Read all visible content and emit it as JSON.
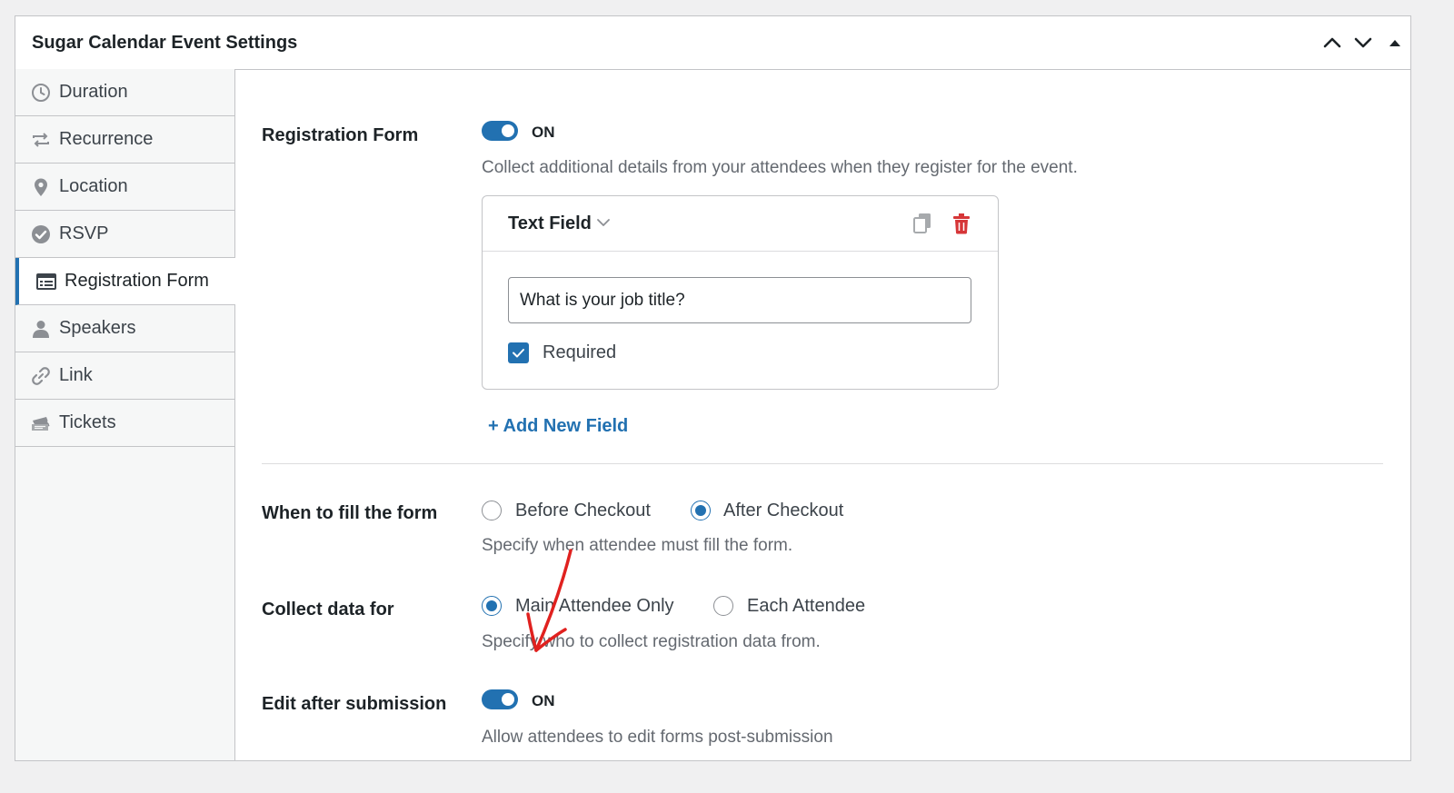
{
  "panel": {
    "title": "Sugar Calendar Event Settings"
  },
  "sidebar": {
    "items": [
      {
        "label": "Duration",
        "icon": "clock-icon"
      },
      {
        "label": "Recurrence",
        "icon": "repeat-icon"
      },
      {
        "label": "Location",
        "icon": "map-pin-icon"
      },
      {
        "label": "RSVP",
        "icon": "check-circle-icon"
      },
      {
        "label": "Registration Form",
        "icon": "form-icon",
        "active": true
      },
      {
        "label": "Speakers",
        "icon": "person-icon"
      },
      {
        "label": "Link",
        "icon": "link-icon"
      },
      {
        "label": "Tickets",
        "icon": "tickets-icon"
      }
    ]
  },
  "registration": {
    "label": "Registration Form",
    "toggle_state": "ON",
    "description": "Collect additional details from your attendees when they register for the event."
  },
  "field": {
    "type": "Text Field",
    "value": "What is your job title?",
    "required_label": "Required",
    "required": true
  },
  "add_field_label": "+ Add New Field",
  "when_fill": {
    "label": "When to fill the form",
    "options": [
      "Before Checkout",
      "After Checkout"
    ],
    "selected": "After Checkout",
    "description": "Specify when attendee must fill the form."
  },
  "collect_for": {
    "label": "Collect data for",
    "options": [
      "Main Attendee Only",
      "Each Attendee"
    ],
    "selected": "Main Attendee Only",
    "description": "Specify who to collect registration data from."
  },
  "edit_after": {
    "label": "Edit after submission",
    "toggle_state": "ON",
    "description": "Allow attendees to edit forms post-submission"
  },
  "colors": {
    "accent": "#2271b1",
    "danger": "#d63638",
    "annotation": "#e0211f"
  }
}
